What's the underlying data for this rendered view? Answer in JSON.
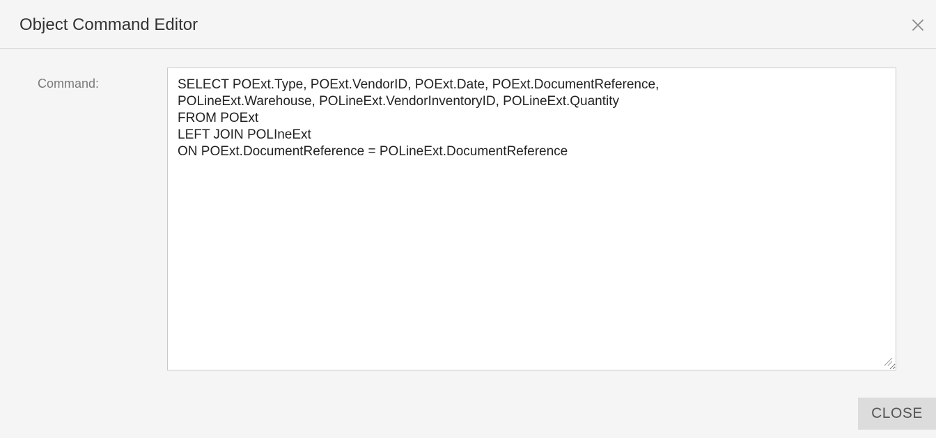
{
  "dialog": {
    "title": "Object Command Editor",
    "close_icon": "close-icon"
  },
  "form": {
    "command_label": "Command:",
    "command_value": "SELECT POExt.Type, POExt.VendorID, POExt.Date, POExt.DocumentReference,\nPOLineExt.Warehouse, POLineExt.VendorInventoryID, POLineExt.Quantity\nFROM POExt\nLEFT JOIN POLIneExt\nON POExt.DocumentReference = POLineExt.DocumentReference"
  },
  "footer": {
    "close_label": "CLOSE"
  }
}
